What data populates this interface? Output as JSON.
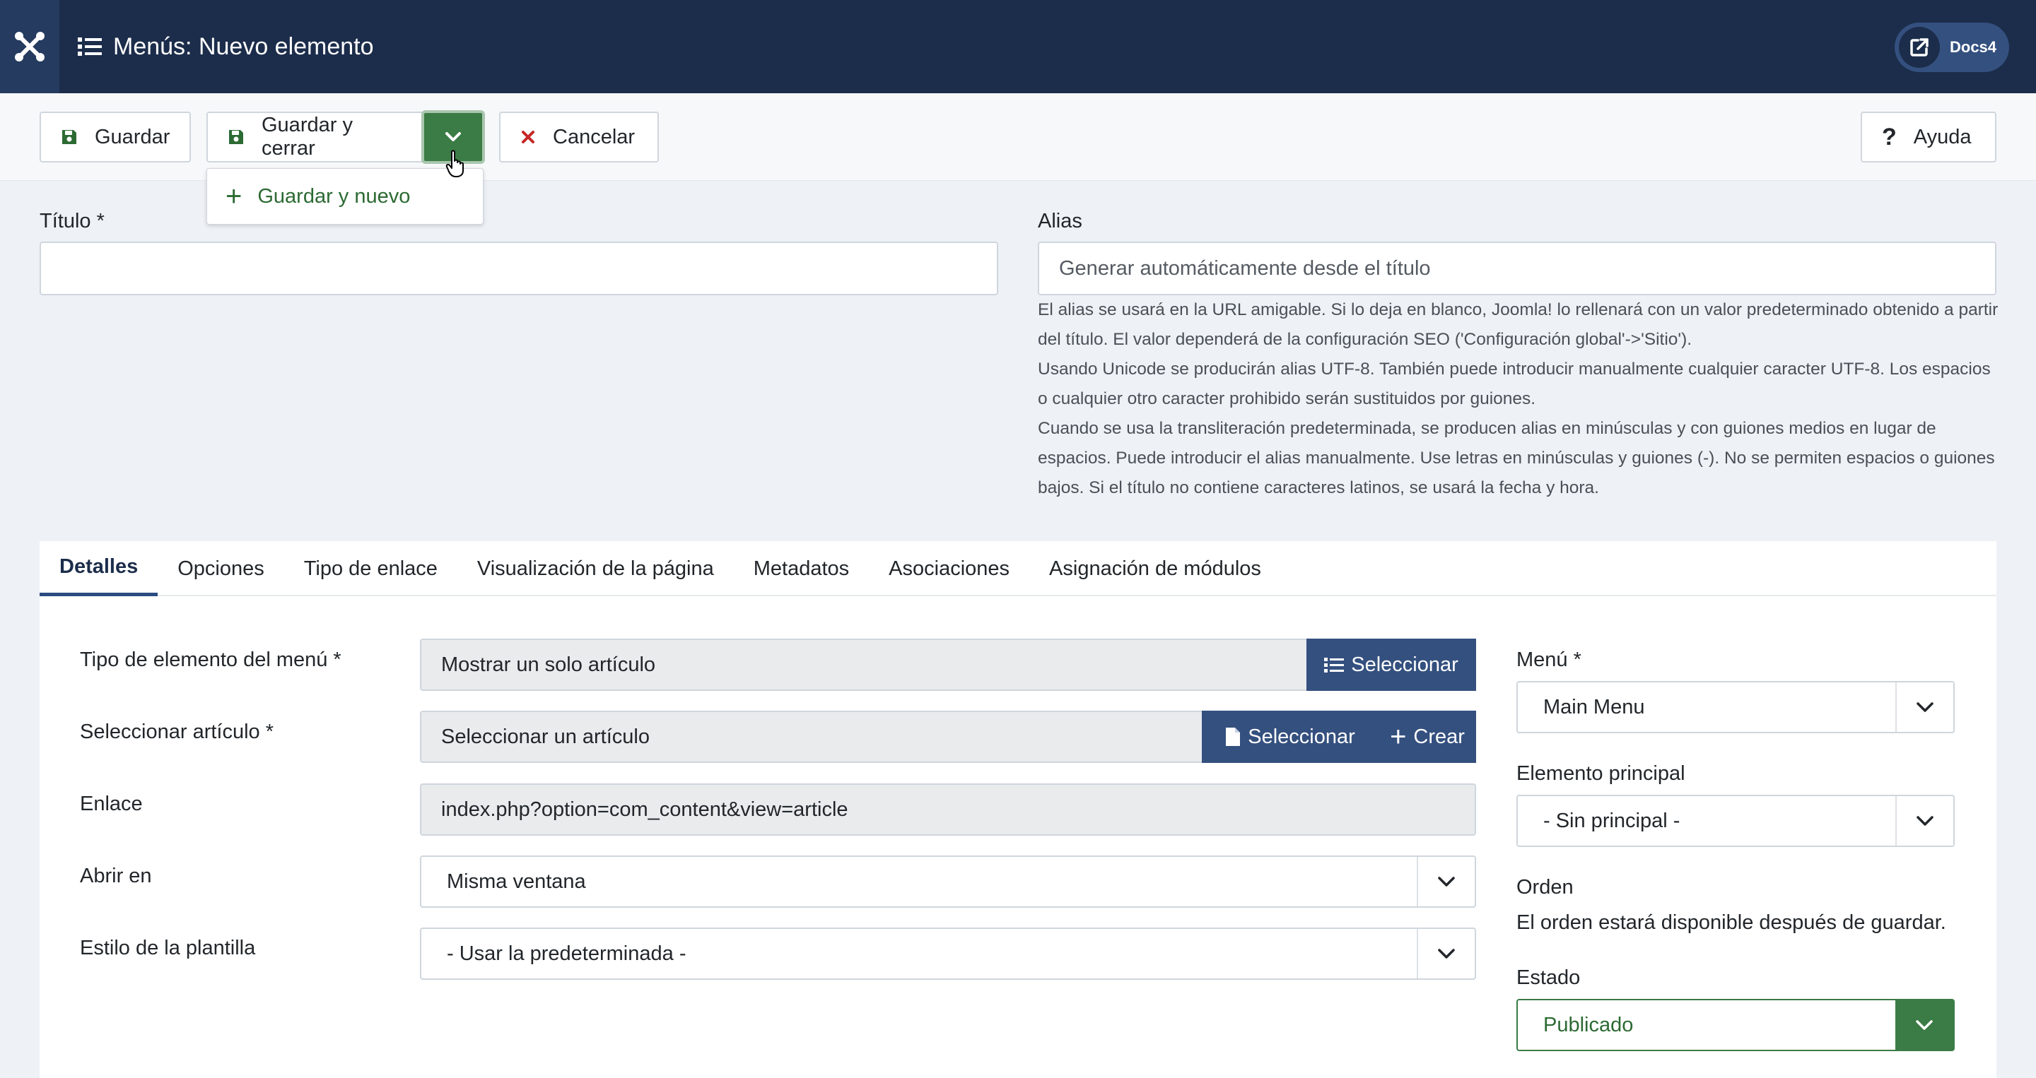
{
  "header": {
    "title": "Menús: Nuevo elemento",
    "site_link_label": "Docs4"
  },
  "toolbar": {
    "save_label": "Guardar",
    "save_close_label": "Guardar y cerrar",
    "cancel_label": "Cancelar",
    "help_label": "Ayuda",
    "dropdown_items": [
      "Guardar y nuevo"
    ]
  },
  "form": {
    "title_label": "Título *",
    "title_value": "",
    "alias_label": "Alias",
    "alias_placeholder": "Generar automáticamente desde el título",
    "alias_help": [
      "El alias se usará en la URL amigable. Si lo deja en blanco, Joomla! lo rellenará con un valor predeterminado obtenido a partir del título. El valor dependerá de la configuración SEO ('Configuración global'->'Sitio').",
      "Usando Unicode se producirán alias UTF-8. También puede introducir manualmente cualquier caracter UTF-8. Los espacios o cualquier otro caracter prohibido serán sustituidos por guiones.",
      "Cuando se usa la transliteración predeterminada, se producen alias en minúsculas y con guiones medios en lugar de espacios. Puede introducir el alias manualmente. Use letras en minúsculas y guiones (-). No se permiten espacios o guiones bajos. Si el título no contiene caracteres latinos, se usará la fecha y hora."
    ]
  },
  "tabs": [
    {
      "label": "Detalles",
      "active": true
    },
    {
      "label": "Opciones"
    },
    {
      "label": "Tipo de enlace"
    },
    {
      "label": "Visualización de la página"
    },
    {
      "label": "Metadatos"
    },
    {
      "label": "Asociaciones"
    },
    {
      "label": "Asignación de módulos"
    }
  ],
  "details": {
    "menu_item_type_label": "Tipo de elemento del menú *",
    "menu_item_type_value": "Mostrar un solo artículo",
    "select_button": "Seleccionar",
    "select_article_label": "Seleccionar artículo *",
    "select_article_value": "Seleccionar un artículo",
    "select_article_button": "Seleccionar",
    "create_button": "Crear",
    "link_label": "Enlace",
    "link_value": "index.php?option=com_content&view=article",
    "open_in_label": "Abrir en",
    "open_in_value": "Misma ventana",
    "template_style_label": "Estilo de la plantilla",
    "template_style_value": "- Usar la predeterminada -"
  },
  "sidebar": {
    "menu_label": "Menú *",
    "menu_value": "Main Menu",
    "parent_label": "Elemento principal",
    "parent_value": "- Sin principal -",
    "order_label": "Orden",
    "order_text": "El orden estará disponible después de guardar.",
    "status_label": "Estado",
    "status_value": "Publicado"
  },
  "colors": {
    "header_bg": "#1c2d4b",
    "primary_blue": "#34507f",
    "success_green": "#3b7b45",
    "danger_red": "#c52827"
  }
}
